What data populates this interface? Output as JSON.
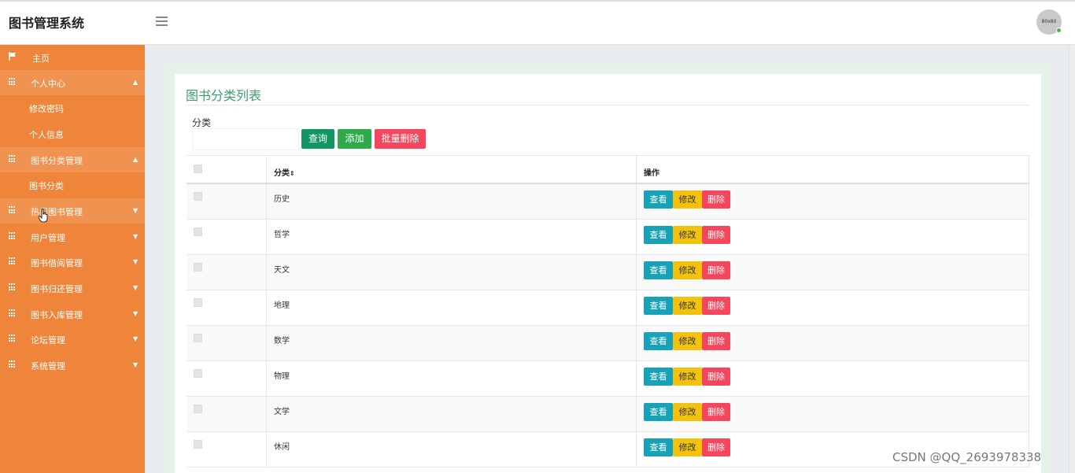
{
  "app": {
    "title": "图书管理系统",
    "avatar_text": "80x80"
  },
  "sidebar": {
    "home": "主页",
    "items": [
      {
        "label": "个人中心",
        "expanded": true
      },
      {
        "label": "修改密码"
      },
      {
        "label": "个人信息"
      },
      {
        "label": "图书分类管理",
        "expanded": true
      },
      {
        "label": "图书分类"
      },
      {
        "label": "热门图书管理"
      },
      {
        "label": "用户管理"
      },
      {
        "label": "图书借阅管理"
      },
      {
        "label": "图书归还管理"
      },
      {
        "label": "图书入库管理"
      },
      {
        "label": "论坛管理"
      },
      {
        "label": "系统管理"
      }
    ]
  },
  "page": {
    "title": "图书分类列表",
    "filter_label": "分类",
    "filter_value": "",
    "search_button": "查询",
    "add_button": "添加",
    "batch_delete_button": "批量删除"
  },
  "table": {
    "headers": {
      "category": "分类",
      "sort_icon": "sort-icon",
      "operations": "操作"
    },
    "actions": {
      "view": "查看",
      "edit": "修改",
      "delete": "删除"
    },
    "rows": [
      {
        "category": "历史"
      },
      {
        "category": "哲学"
      },
      {
        "category": "天文"
      },
      {
        "category": "地理"
      },
      {
        "category": "数学"
      },
      {
        "category": "物理"
      },
      {
        "category": "文学"
      },
      {
        "category": "休闲"
      }
    ]
  },
  "watermark": "CSDN @QQ_2693978338",
  "colors": {
    "sidebar": "#ee853a",
    "title_green": "#3aa06b",
    "view": "#17a2b8",
    "edit": "#f3c20c",
    "delete": "#f4475e"
  }
}
